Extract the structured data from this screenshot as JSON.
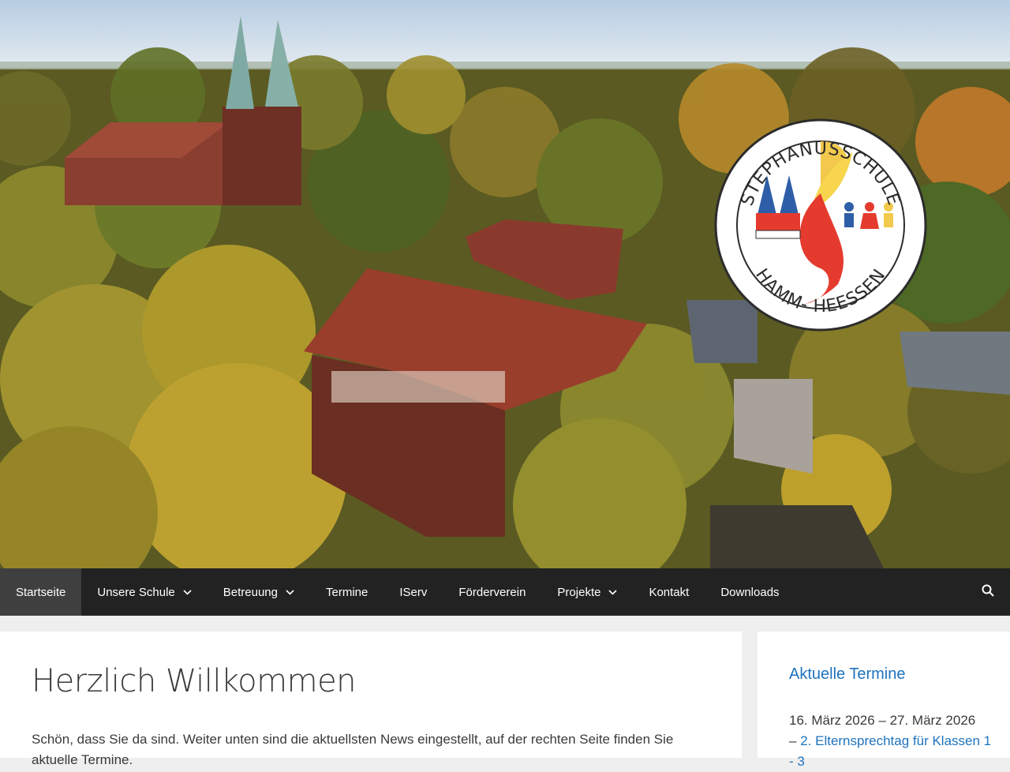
{
  "logo": {
    "top_text": "STEPHANUSSCHULE",
    "bottom_text": "HAMM- HEESSEN"
  },
  "nav": {
    "items": [
      {
        "label": "Startseite",
        "active": true,
        "has_dropdown": false
      },
      {
        "label": "Unsere Schule",
        "active": false,
        "has_dropdown": true
      },
      {
        "label": "Betreuung",
        "active": false,
        "has_dropdown": true
      },
      {
        "label": "Termine",
        "active": false,
        "has_dropdown": false
      },
      {
        "label": "IServ",
        "active": false,
        "has_dropdown": false
      },
      {
        "label": "Förderverein",
        "active": false,
        "has_dropdown": false
      },
      {
        "label": "Projekte",
        "active": false,
        "has_dropdown": true
      },
      {
        "label": "Kontakt",
        "active": false,
        "has_dropdown": false
      },
      {
        "label": "Downloads",
        "active": false,
        "has_dropdown": false
      }
    ],
    "search_icon": "search-icon"
  },
  "main": {
    "title": "Herzlich Willkommen",
    "intro": "Schön, dass Sie da sind. Weiter unten sind die aktuellsten News eingestellt, auf der rechten Seite finden Sie aktuelle Termine."
  },
  "sidebar": {
    "widget_title": "Aktuelle Termine",
    "events": [
      {
        "date": "16. März 2026 – 27. März 2026",
        "prefix": "–",
        "link": "2. Elternsprechtag für Klassen 1 - 3"
      }
    ]
  },
  "colors": {
    "nav_bg": "#222222",
    "nav_active": "#3f3f3f",
    "link": "#1e73be",
    "text": "#3a3a3a",
    "page_bg": "#efefef"
  }
}
